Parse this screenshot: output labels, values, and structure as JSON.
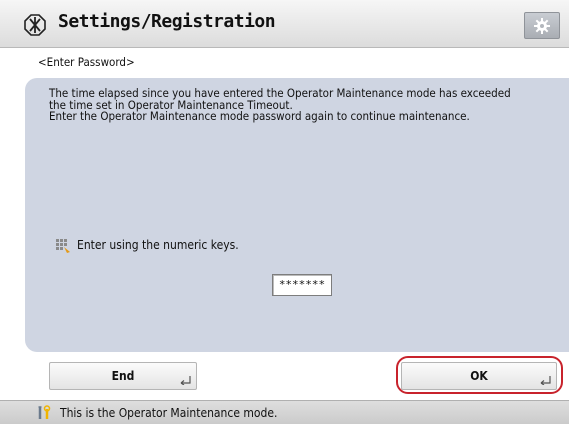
{
  "header": {
    "title": "Settings/Registration",
    "settings_icon": "gear-icon"
  },
  "page": {
    "subtitle": "<Enter Password>",
    "message_lines": [
      "The time elapsed since you have entered the Operator Maintenance mode has exceeded",
      "the time set in Operator Maintenance Timeout.",
      "Enter the Operator Maintenance mode password again to continue maintenance."
    ],
    "hint": "Enter using the numeric keys.",
    "password_value": "*******"
  },
  "buttons": {
    "end_label": "End",
    "ok_label": "OK"
  },
  "status": {
    "text": "This is the Operator Maintenance mode.",
    "icon": "tools-icon"
  },
  "colors": {
    "panel": "#cfd5e2",
    "highlight": "#c8232c"
  }
}
